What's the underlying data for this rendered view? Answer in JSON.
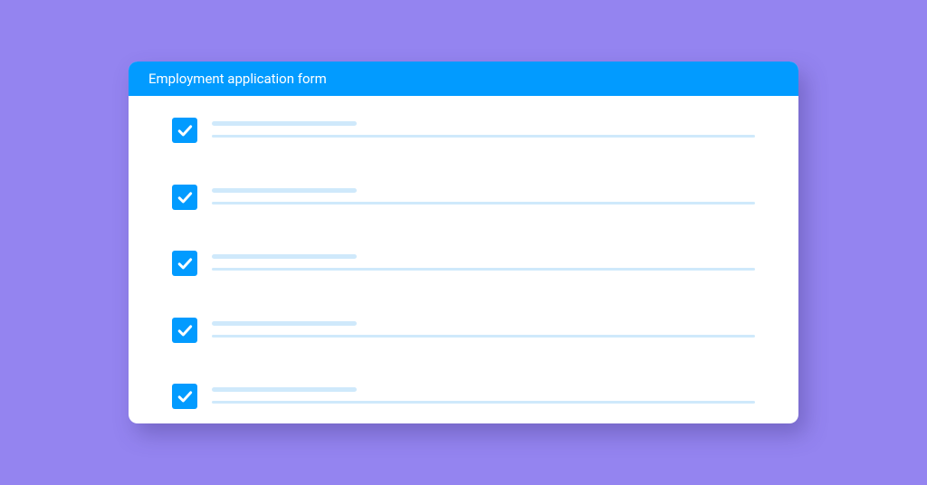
{
  "header": {
    "title": "Employment application form"
  },
  "items": [
    {
      "checked": true
    },
    {
      "checked": true
    },
    {
      "checked": true
    },
    {
      "checked": true
    },
    {
      "checked": true
    }
  ],
  "colors": {
    "background": "#9484f0",
    "accent": "#029bff",
    "placeholder": "#cfe9fb",
    "card": "#ffffff"
  }
}
